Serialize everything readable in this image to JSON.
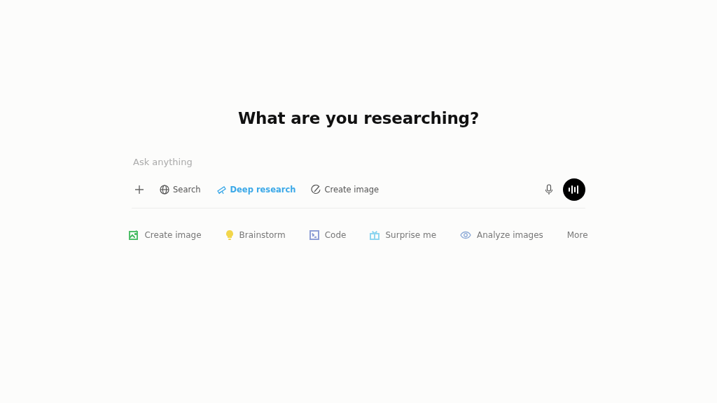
{
  "heading": "What are you researching?",
  "composer": {
    "placeholder": "Ask anything",
    "tools": [
      {
        "kind": "plus",
        "selected": false
      },
      {
        "kind": "globe",
        "label": "Search",
        "selected": false
      },
      {
        "kind": "telescope",
        "label": "Deep research",
        "selected": true
      },
      {
        "kind": "brush",
        "label": "Create image",
        "selected": false
      }
    ]
  },
  "suggestions": [
    {
      "kind": "image",
      "label": "Create image",
      "color": "#4fbf6a"
    },
    {
      "kind": "bulb",
      "label": "Brainstorm",
      "color": "#f2d64b"
    },
    {
      "kind": "code",
      "label": "Code",
      "color": "#8f9fd6"
    },
    {
      "kind": "gift",
      "label": "Surprise me",
      "color": "#8fd6f0"
    },
    {
      "kind": "eye",
      "label": "Analyze images",
      "color": "#8aa8d6"
    },
    {
      "kind": "more",
      "label": "More"
    }
  ]
}
